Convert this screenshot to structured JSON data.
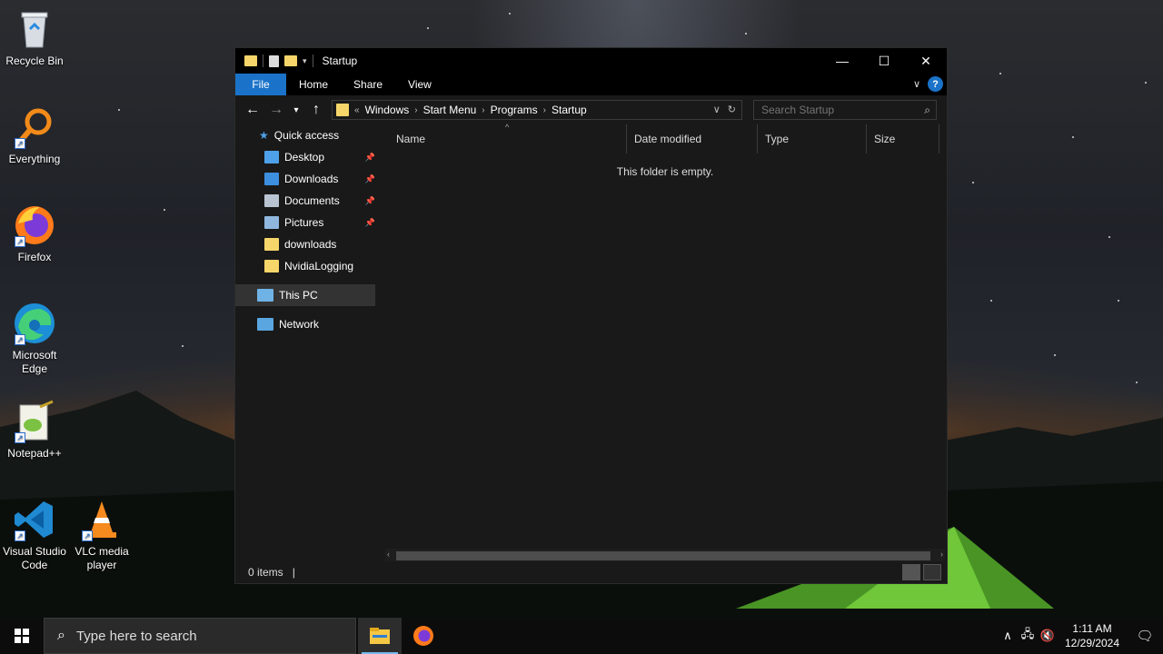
{
  "desktop": {
    "icons": [
      {
        "label": "Recycle Bin"
      },
      {
        "label": "Everything"
      },
      {
        "label": "Firefox"
      },
      {
        "label": "Microsoft Edge"
      },
      {
        "label": "Notepad++"
      },
      {
        "label": "Visual Studio Code"
      },
      {
        "label": "VLC media player"
      }
    ]
  },
  "window": {
    "title": "Startup",
    "controls": {
      "minimize": "—",
      "maximize": "☐",
      "close": "✕"
    },
    "ribbon": {
      "tabs": [
        "File",
        "Home",
        "Share",
        "View"
      ],
      "help": "?"
    },
    "address": {
      "overflow": "«",
      "crumbs": [
        "Windows",
        "Start Menu",
        "Programs",
        "Startup"
      ]
    },
    "search": {
      "placeholder": "Search Startup"
    },
    "nav": {
      "quick_access": "Quick access",
      "items": [
        {
          "label": "Desktop",
          "pinned": true,
          "color": "#4ea1e8"
        },
        {
          "label": "Downloads",
          "pinned": true,
          "color": "#3d8fe0"
        },
        {
          "label": "Documents",
          "pinned": true,
          "color": "#b9c4d2"
        },
        {
          "label": "Pictures",
          "pinned": true,
          "color": "#8fb7de"
        },
        {
          "label": "downloads",
          "pinned": false,
          "color": "#f6d56a"
        },
        {
          "label": "NvidiaLogging",
          "pinned": false,
          "color": "#f6d56a"
        }
      ],
      "this_pc": "This PC",
      "network": "Network"
    },
    "columns": [
      "Name",
      "Date modified",
      "Type",
      "Size"
    ],
    "empty_message": "This folder is empty.",
    "status": {
      "items": "0 items"
    }
  },
  "taskbar": {
    "search_placeholder": "Type here to search",
    "time": "1:11 AM",
    "date": "12/29/2024"
  },
  "colors": {
    "accent": "#1a73c8",
    "folder": "#f6d56a"
  }
}
